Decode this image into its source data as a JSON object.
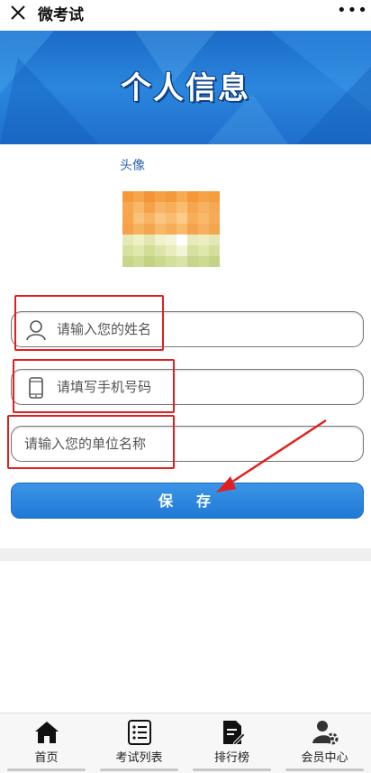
{
  "header": {
    "app_title": "微考试",
    "close_icon": "close-icon",
    "more_icon": "more-dots-icon",
    "more_label": "•••"
  },
  "banner": {
    "title": "个人信息"
  },
  "avatar": {
    "label": "头像"
  },
  "form": {
    "name_placeholder": "请输入您的姓名",
    "phone_placeholder": "请填写手机号码",
    "unit_placeholder": "请输入您的单位名称",
    "save_label": "保存"
  },
  "tabs": [
    {
      "label": "首页",
      "icon": "home-icon"
    },
    {
      "label": "考试列表",
      "icon": "list-icon"
    },
    {
      "label": "排行榜",
      "icon": "ranking-icon"
    },
    {
      "label": "会员中心",
      "icon": "member-center-icon"
    }
  ],
  "colors": {
    "accent": "#1f7ad6",
    "banner": "#2b86dd",
    "annotation": "#e02020"
  }
}
